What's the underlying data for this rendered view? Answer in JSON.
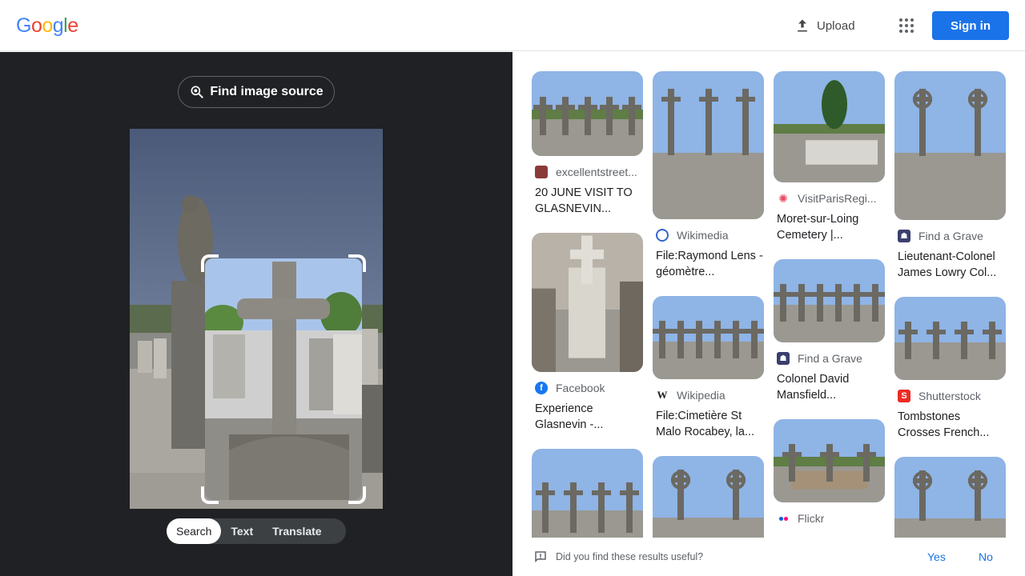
{
  "header": {
    "logo_letters": [
      {
        "ch": "G",
        "color": "#4285F4"
      },
      {
        "ch": "o",
        "color": "#EA4335"
      },
      {
        "ch": "o",
        "color": "#FBBC05"
      },
      {
        "ch": "g",
        "color": "#4285F4"
      },
      {
        "ch": "l",
        "color": "#34A853"
      },
      {
        "ch": "e",
        "color": "#EA4335"
      }
    ],
    "upload_label": "Upload",
    "apps_icon": "apps-grid-icon",
    "signin_label": "Sign in"
  },
  "left": {
    "find_source_label": "Find image source",
    "modes": [
      {
        "label": "Search",
        "active": true
      },
      {
        "label": "Text",
        "active": false
      },
      {
        "label": "Translate",
        "active": false
      }
    ]
  },
  "columns": [
    [
      {
        "source": "excellentstreet...",
        "title": "20 JUNE VISIT TO GLASNEVIN...",
        "fav": "excellentstreet-favicon",
        "fav_color": "#8b3a3a",
        "thumb_h": 106,
        "scene": "graves"
      },
      {
        "source": "Facebook",
        "title": "Experience Glasnevin -...",
        "fav": "facebook-icon",
        "fav_color": "#1877f2",
        "thumb_h": 174,
        "scene": "headstone"
      },
      {
        "source": "",
        "title": "",
        "fav": "",
        "fav_color": "",
        "thumb_h": 140,
        "scene": "crosses"
      }
    ],
    [
      {
        "source": "Wikimedia",
        "title": "File:Raymond Lens - géomètre...",
        "fav": "wikimedia-icon",
        "fav_color": "#3366cc",
        "thumb_h": 185,
        "scene": "cross"
      },
      {
        "source": "Wikipedia",
        "title": "File:Cimetière St Malo Rocabey, la...",
        "fav": "wikipedia-icon",
        "fav_color": "#ffffff",
        "thumb_h": 104,
        "scene": "wide"
      },
      {
        "source": "",
        "title": "",
        "fav": "",
        "fav_color": "",
        "thumb_h": 140,
        "scene": "celtic"
      }
    ],
    [
      {
        "source": "VisitParisRegi...",
        "title": "Moret-sur-Loing Cemetery |...",
        "fav": "visitparis-icon",
        "fav_color": "#f4a22b",
        "thumb_h": 139,
        "scene": "tree"
      },
      {
        "source": "Find a Grave",
        "title": "Colonel David Mansfield...",
        "fav": "findagrave-icon",
        "fav_color": "#3b3f6e",
        "thumb_h": 104,
        "scene": "wide"
      },
      {
        "source": "Flickr",
        "title": "",
        "fav": "flickr-icon",
        "fav_color": "#ffffff",
        "thumb_h": 104,
        "scene": "plot"
      }
    ],
    [
      {
        "source": "Find a Grave",
        "title": "Lieutenant-Colonel James Lowry Col...",
        "fav": "findagrave-icon",
        "fav_color": "#3b3f6e",
        "thumb_h": 186,
        "scene": "celtic"
      },
      {
        "source": "Shutterstock",
        "title": "Tombstones Crosses French...",
        "fav": "shutterstock-icon",
        "fav_color": "#ee2b24",
        "thumb_h": 104,
        "scene": "crosses"
      },
      {
        "source": "",
        "title": "",
        "fav": "",
        "fav_color": "",
        "thumb_h": 140,
        "scene": "celtic"
      }
    ]
  ],
  "feedback": {
    "question": "Did you find these results useful?",
    "yes": "Yes",
    "no": "No"
  }
}
